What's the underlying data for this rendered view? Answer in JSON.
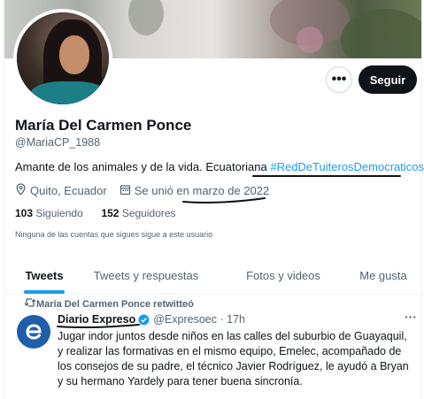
{
  "profile": {
    "name": "María Del Carmen Ponce",
    "handle": "@MariaCP_1988",
    "bio_text": "Amante de los animales y de la vida. Ecuatoriana ",
    "bio_hashtag": "#RedDeTuiterosDemocraticos",
    "location": "Quito, Ecuador",
    "joined": "Se unió en marzo de 2022",
    "following_count": "103",
    "following_label": "Siguiendo",
    "followers_count": "152",
    "followers_label": "Seguidores",
    "followers_notice": "Ninguna de las cuentas que sigues sigue a este usuario"
  },
  "actions": {
    "more_label": "•••",
    "follow_label": "Seguir"
  },
  "tabs": [
    {
      "label": "Tweets",
      "active": true
    },
    {
      "label": "Tweets y respuestas",
      "active": false
    },
    {
      "label": "Fotos y videos",
      "active": false
    },
    {
      "label": "Me gusta",
      "active": false
    }
  ],
  "tweet": {
    "retweet_label": "María Del Carmen Ponce retwitteó",
    "author_name": "Diario Expreso",
    "author_handle": "@Expresoec · 17h",
    "more_label": "···",
    "text": "Jugar indor juntos desde niños en las calles del suburbio de Guayaquil, y realizar las formativas en el mismo equipo, Emelec, acompañado de los consejos de su padre, el técnico Javier Rodríguez, le ayudó a Bryan y su hermano Yardely para tener buena sincronía."
  },
  "colors": {
    "accent": "#1d9bf0",
    "text": "#0f1419",
    "muted": "#536471",
    "button_dark": "#0f1419"
  },
  "icons": [
    "location-icon",
    "calendar-icon",
    "retweet-icon",
    "verified-icon",
    "diario-expreso-logo"
  ]
}
